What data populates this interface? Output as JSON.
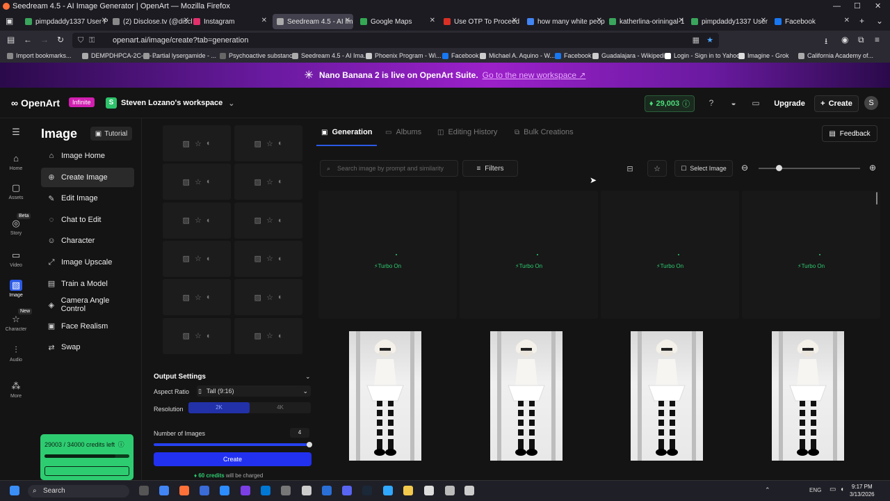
{
  "window": {
    "title": "Seedream 4.5 - AI Image Generator | OpenArt — Mozilla Firefox"
  },
  "tabs": [
    {
      "label": "pimpdaddy1337 User P",
      "color": "#3aa55c",
      "active": false
    },
    {
      "label": "(2) Disclose.tv (@disclo",
      "color": "#888888",
      "active": false
    },
    {
      "label": "Instagram",
      "color": "#e1306c",
      "active": false
    },
    {
      "label": "Seedream 4.5 - AI Imag",
      "color": "#aaaaaa",
      "active": true
    },
    {
      "label": "Google Maps",
      "color": "#34a853",
      "active": false
    },
    {
      "label": "Use OTP To Proceed - j",
      "color": "#d93025",
      "active": false
    },
    {
      "label": "how many white peopl",
      "color": "#4285f4",
      "active": false
    },
    {
      "label": "katherlina-oriningal-1",
      "color": "#3aa55c",
      "active": false
    },
    {
      "label": "pimpdaddy1337 User P",
      "color": "#3aa55c",
      "active": false
    },
    {
      "label": "Facebook",
      "color": "#1877f2",
      "active": false
    }
  ],
  "url": "openart.ai/image/create?tab=generation",
  "bookmarks": [
    "Import bookmarks...",
    "DEMPDHPCA-2C-D - ...",
    "Partial lysergamide - ...",
    "Psychoactive substanc...",
    "Seedream 4.5 - AI Ima...",
    "Phoenix Program - Wi...",
    "Facebook",
    "Michael A. Aquino - W...",
    "Facebook",
    "Guadalajara - Wikipedia",
    "Login - Sign in to Yahoo",
    "Imagine - Grok",
    "California Academy of..."
  ],
  "banner": {
    "text": "Nano Banana 2 is live on OpenArt Suite.",
    "link": "Go to the new workspace ↗"
  },
  "header": {
    "logo": "OpenArt",
    "plan_badge": "Infinite",
    "workspace": "Steven Lozano's workspace",
    "workspace_initial": "S",
    "credits": "29,003",
    "upgrade": "Upgrade",
    "create": "Create",
    "user_initial": "S"
  },
  "rail": {
    "items": [
      {
        "label": "",
        "icon": "menu-icon"
      },
      {
        "label": "Home",
        "icon": "home-icon"
      },
      {
        "label": "Assets",
        "icon": "folder-icon"
      },
      {
        "label": "Story",
        "icon": "story-icon"
      },
      {
        "label": "Video",
        "icon": "video-icon"
      },
      {
        "label": "Image",
        "icon": "image-icon"
      },
      {
        "label": "Character",
        "icon": "character-icon"
      },
      {
        "label": "Audio",
        "icon": "audio-icon"
      },
      {
        "label": "More",
        "icon": "more-icon"
      }
    ],
    "beta": "Beta",
    "new": "New"
  },
  "menu": {
    "heading": "Image",
    "tutorial": "Tutorial",
    "items": [
      {
        "label": "Image Home"
      },
      {
        "label": "Create Image"
      },
      {
        "label": "Edit Image"
      },
      {
        "label": "Chat to Edit"
      },
      {
        "label": "Character"
      },
      {
        "label": "Image Upscale"
      },
      {
        "label": "Train a Model"
      },
      {
        "label": "Camera Angle Control"
      },
      {
        "label": "Face Realism"
      },
      {
        "label": "Swap"
      }
    ],
    "credits_left": "29003 / 34000 credits left"
  },
  "output": {
    "title": "Output Settings",
    "aspect_label": "Aspect Ratio",
    "aspect_value": "Tall (9:16)",
    "resolution_label": "Resolution",
    "res_options": [
      "2K",
      "4K"
    ],
    "num_label": "Number of Images",
    "num_value": "4",
    "create": "Create",
    "charged_amount": "60 credits",
    "charged_suffix": "will be charged"
  },
  "main": {
    "tabs": [
      "Generation",
      "Albums",
      "Editing History",
      "Bulk Creations"
    ],
    "feedback": "Feedback",
    "search_placeholder": "Search image by prompt and similarity",
    "filters": "Filters",
    "select_image": "Select Image",
    "turbo": "Turbo On"
  },
  "taskbar": {
    "search": "Search",
    "lang": "ENG",
    "time": "9:17 PM",
    "date": "3/13/2026"
  }
}
